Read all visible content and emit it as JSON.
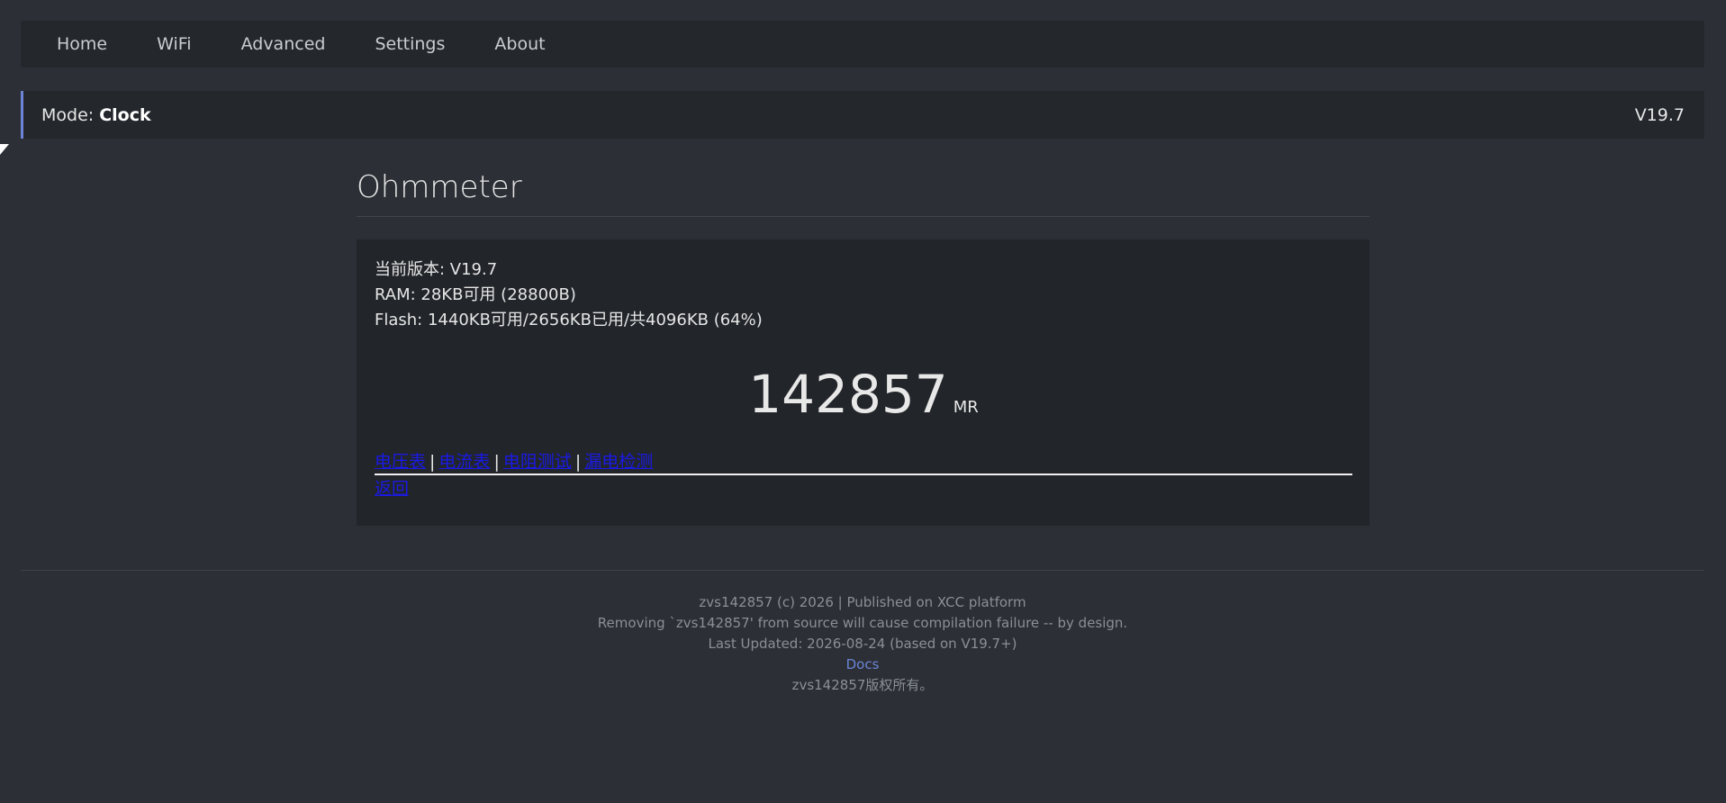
{
  "nav": {
    "items": [
      {
        "label": "Home"
      },
      {
        "label": "WiFi"
      },
      {
        "label": "Advanced"
      },
      {
        "label": "Settings"
      },
      {
        "label": "About"
      }
    ]
  },
  "mode": {
    "label": "Mode: ",
    "value": "Clock",
    "version": "V19.7"
  },
  "page": {
    "title": "Ohmmeter"
  },
  "info": {
    "version_line": "当前版本: V19.7",
    "ram_line": "RAM: 28KB可用 (28800B)",
    "flash_line": "Flash: 1440KB可用/2656KB已用/共4096KB (64%)"
  },
  "reading": {
    "value": "142857",
    "unit": "MR"
  },
  "links": {
    "items": [
      {
        "label": "电压表"
      },
      {
        "label": "电流表"
      },
      {
        "label": "电阻测试"
      },
      {
        "label": "漏电检测"
      }
    ],
    "separator": "|",
    "back": "返回"
  },
  "footer": {
    "line1": "zvs142857 (c) 2026 | Published on XCC platform",
    "line2": "Removing `zvs142857' from source will cause compilation failure -- by design.",
    "line3": "Last Updated: 2026-08-24 (based on V19.7+)",
    "docs": "Docs",
    "line4": "zvs142857版权所有。"
  },
  "colors": {
    "background": "#2c2f35",
    "panel": "#24272c",
    "accent": "#6b84d6",
    "link": "#1a1ae6"
  }
}
